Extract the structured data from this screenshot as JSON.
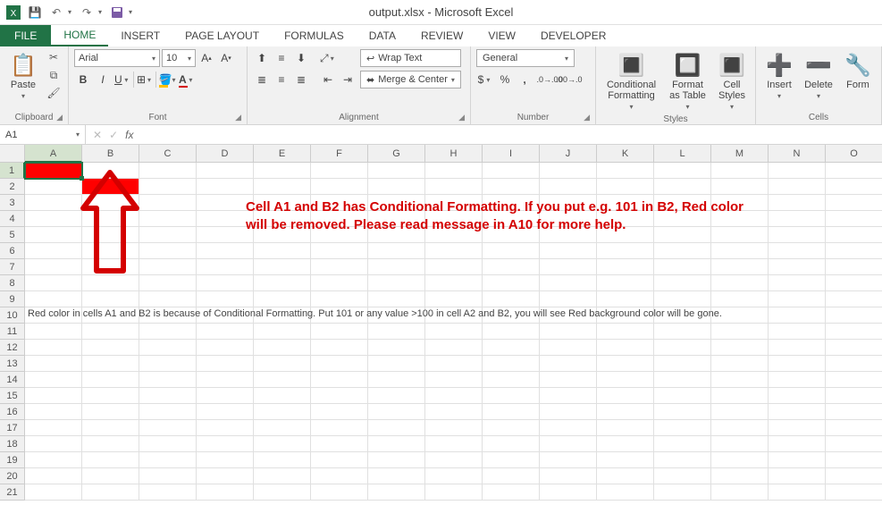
{
  "title": "output.xlsx - Microsoft Excel",
  "tabs": {
    "file": "FILE",
    "home": "HOME",
    "insert": "INSERT",
    "pageLayout": "PAGE LAYOUT",
    "formulas": "FORMULAS",
    "data": "DATA",
    "review": "REVIEW",
    "view": "VIEW",
    "developer": "DEVELOPER"
  },
  "clipboard": {
    "paste": "Paste",
    "label": "Clipboard"
  },
  "font": {
    "name": "Arial",
    "size": "10",
    "label": "Font"
  },
  "alignment": {
    "wrap": "Wrap Text",
    "merge": "Merge & Center",
    "label": "Alignment"
  },
  "number": {
    "format": "General",
    "label": "Number"
  },
  "styles": {
    "cond": "Conditional Formatting",
    "table": "Format as Table",
    "cell": "Cell Styles",
    "label": "Styles"
  },
  "cellsGroup": {
    "insert": "Insert",
    "delete": "Delete",
    "format": "Form",
    "label": "Cells"
  },
  "namebox": "A1",
  "columns": [
    "A",
    "B",
    "C",
    "D",
    "E",
    "F",
    "G",
    "H",
    "I",
    "J",
    "K",
    "L",
    "M",
    "N",
    "O"
  ],
  "rowCount": 21,
  "note_line1": "Cell A1 and B2 has Conditional Formatting. If you put e.g. 101 in B2, Red color",
  "note_line2": "will be removed. Please read message in A10 for more help.",
  "a10_text": "Red color in cells A1 and B2 is because of Conditional Formatting. Put 101 or any value >100 in cell A2 and B2, you will see Red background color will be gone.",
  "chart_data": null
}
